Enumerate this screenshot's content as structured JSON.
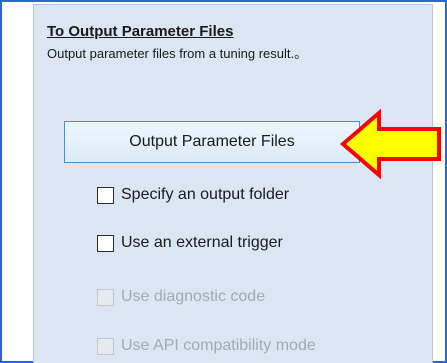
{
  "section": {
    "title": "To Output Parameter Files",
    "description": "Output parameter files from a tuning result.。"
  },
  "actions": {
    "output_button_label": "Output Parameter Files"
  },
  "options": [
    {
      "label": "Specify an output folder",
      "checked": false,
      "enabled": true
    },
    {
      "label": "Use an external trigger",
      "checked": false,
      "enabled": true
    },
    {
      "label": "Use diagnostic code",
      "checked": false,
      "enabled": false
    },
    {
      "label": "Use API compatibility mode",
      "checked": false,
      "enabled": false
    }
  ],
  "colors": {
    "panel_background": "#dce5f3",
    "frame_border": "#2f66c9",
    "button_border": "#4a90c8",
    "arrow_fill": "#ffff00",
    "arrow_stroke": "#ff0000",
    "disabled_text": "#a5a9b0"
  },
  "icons": {
    "callout": "arrow-left-icon"
  }
}
